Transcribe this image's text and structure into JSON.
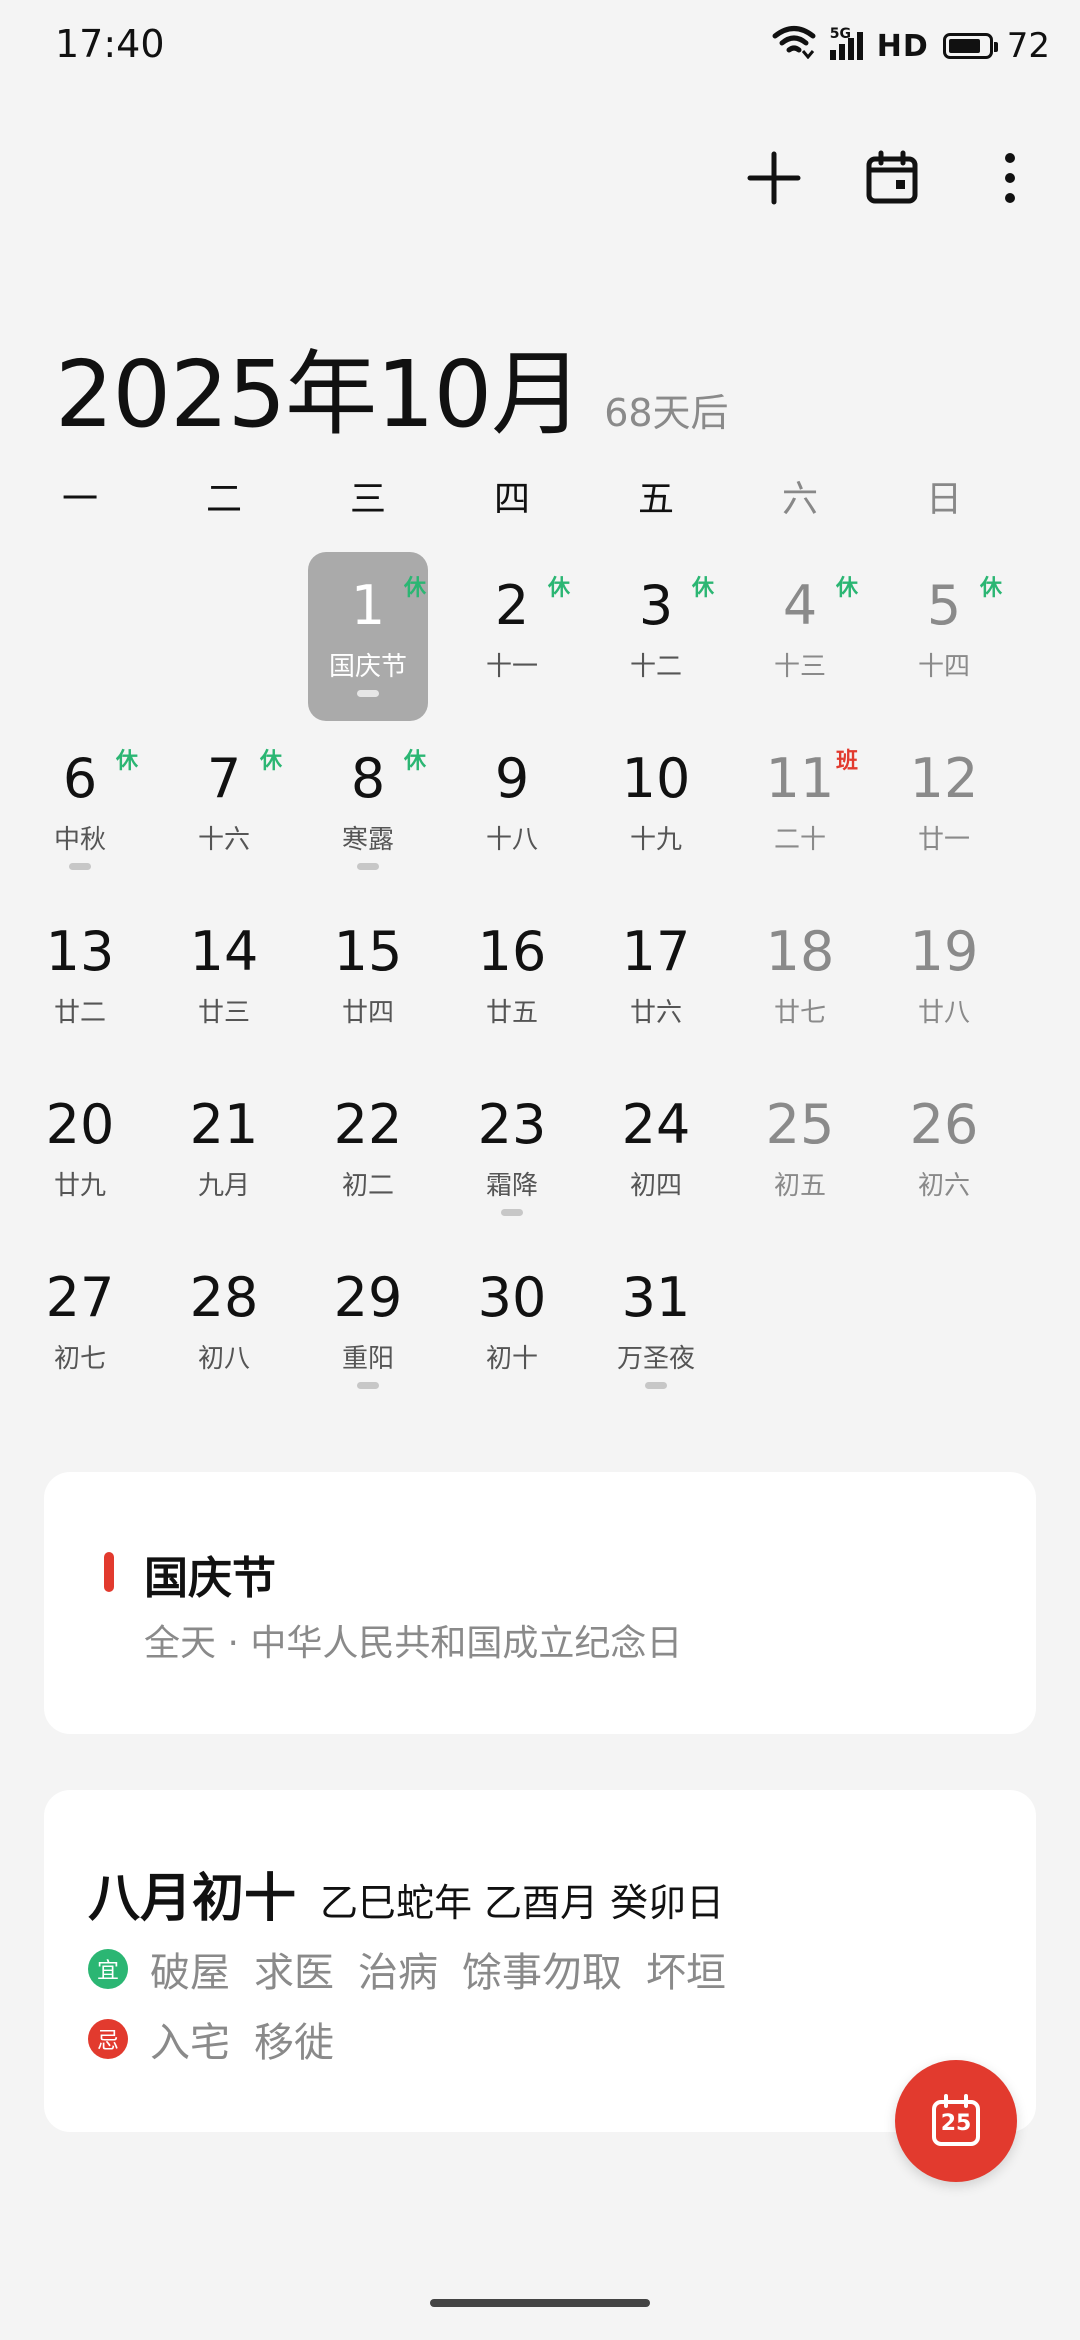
{
  "status_bar": {
    "time": "17:40",
    "network": "5G",
    "hd": "HD",
    "battery": "72"
  },
  "actions": {
    "add_icon": "plus-icon",
    "calendar_icon": "calendar-icon",
    "more_icon": "more-vertical-icon"
  },
  "header": {
    "month": "2025年10月",
    "subtitle": "68天后"
  },
  "weekdays": [
    "一",
    "二",
    "三",
    "四",
    "五",
    "六",
    "日"
  ],
  "grid": {
    "rows": [
      [
        null,
        null,
        {
          "day": "1",
          "lunar": "国庆节",
          "badge": "休",
          "dot": true,
          "selected": true
        },
        {
          "day": "2",
          "lunar": "十一",
          "badge": "休"
        },
        {
          "day": "3",
          "lunar": "十二",
          "badge": "休"
        },
        {
          "day": "4",
          "lunar": "十三",
          "badge": "休"
        },
        {
          "day": "5",
          "lunar": "十四",
          "badge": "休"
        }
      ],
      [
        {
          "day": "6",
          "lunar": "中秋",
          "badge": "休",
          "dot": true
        },
        {
          "day": "7",
          "lunar": "十六",
          "badge": "休"
        },
        {
          "day": "8",
          "lunar": "寒露",
          "badge": "休",
          "dot": true
        },
        {
          "day": "9",
          "lunar": "十八"
        },
        {
          "day": "10",
          "lunar": "十九"
        },
        {
          "day": "11",
          "lunar": "二十",
          "badge": "班"
        },
        {
          "day": "12",
          "lunar": "廿一"
        }
      ],
      [
        {
          "day": "13",
          "lunar": "廿二"
        },
        {
          "day": "14",
          "lunar": "廿三"
        },
        {
          "day": "15",
          "lunar": "廿四"
        },
        {
          "day": "16",
          "lunar": "廿五"
        },
        {
          "day": "17",
          "lunar": "廿六"
        },
        {
          "day": "18",
          "lunar": "廿七"
        },
        {
          "day": "19",
          "lunar": "廿八"
        }
      ],
      [
        {
          "day": "20",
          "lunar": "廿九"
        },
        {
          "day": "21",
          "lunar": "九月"
        },
        {
          "day": "22",
          "lunar": "初二"
        },
        {
          "day": "23",
          "lunar": "霜降",
          "dot": true
        },
        {
          "day": "24",
          "lunar": "初四"
        },
        {
          "day": "25",
          "lunar": "初五"
        },
        {
          "day": "26",
          "lunar": "初六"
        }
      ],
      [
        {
          "day": "27",
          "lunar": "初七"
        },
        {
          "day": "28",
          "lunar": "初八"
        },
        {
          "day": "29",
          "lunar": "重阳",
          "dot": true
        },
        {
          "day": "30",
          "lunar": "初十"
        },
        {
          "day": "31",
          "lunar": "万圣夜",
          "dot": true
        },
        null,
        null
      ]
    ]
  },
  "holiday": {
    "title": "国庆节",
    "desc": "全天 · 中华人民共和国成立纪念日"
  },
  "almanac": {
    "lunar_date": "八月初十",
    "ganzhi": "乙巳蛇年 乙酉月 癸卯日",
    "yi_label": "宜",
    "yi_items": [
      "破屋",
      "求医",
      "治病",
      "馀事勿取",
      "坏垣"
    ],
    "ji_label": "忌",
    "ji_items": [
      "入宅",
      "移徙"
    ]
  },
  "fab": {
    "label": "25"
  },
  "colors": {
    "accent_red": "#e23a2e",
    "holiday_green": "#2bb673",
    "selected_bg": "#aaaaaa"
  }
}
